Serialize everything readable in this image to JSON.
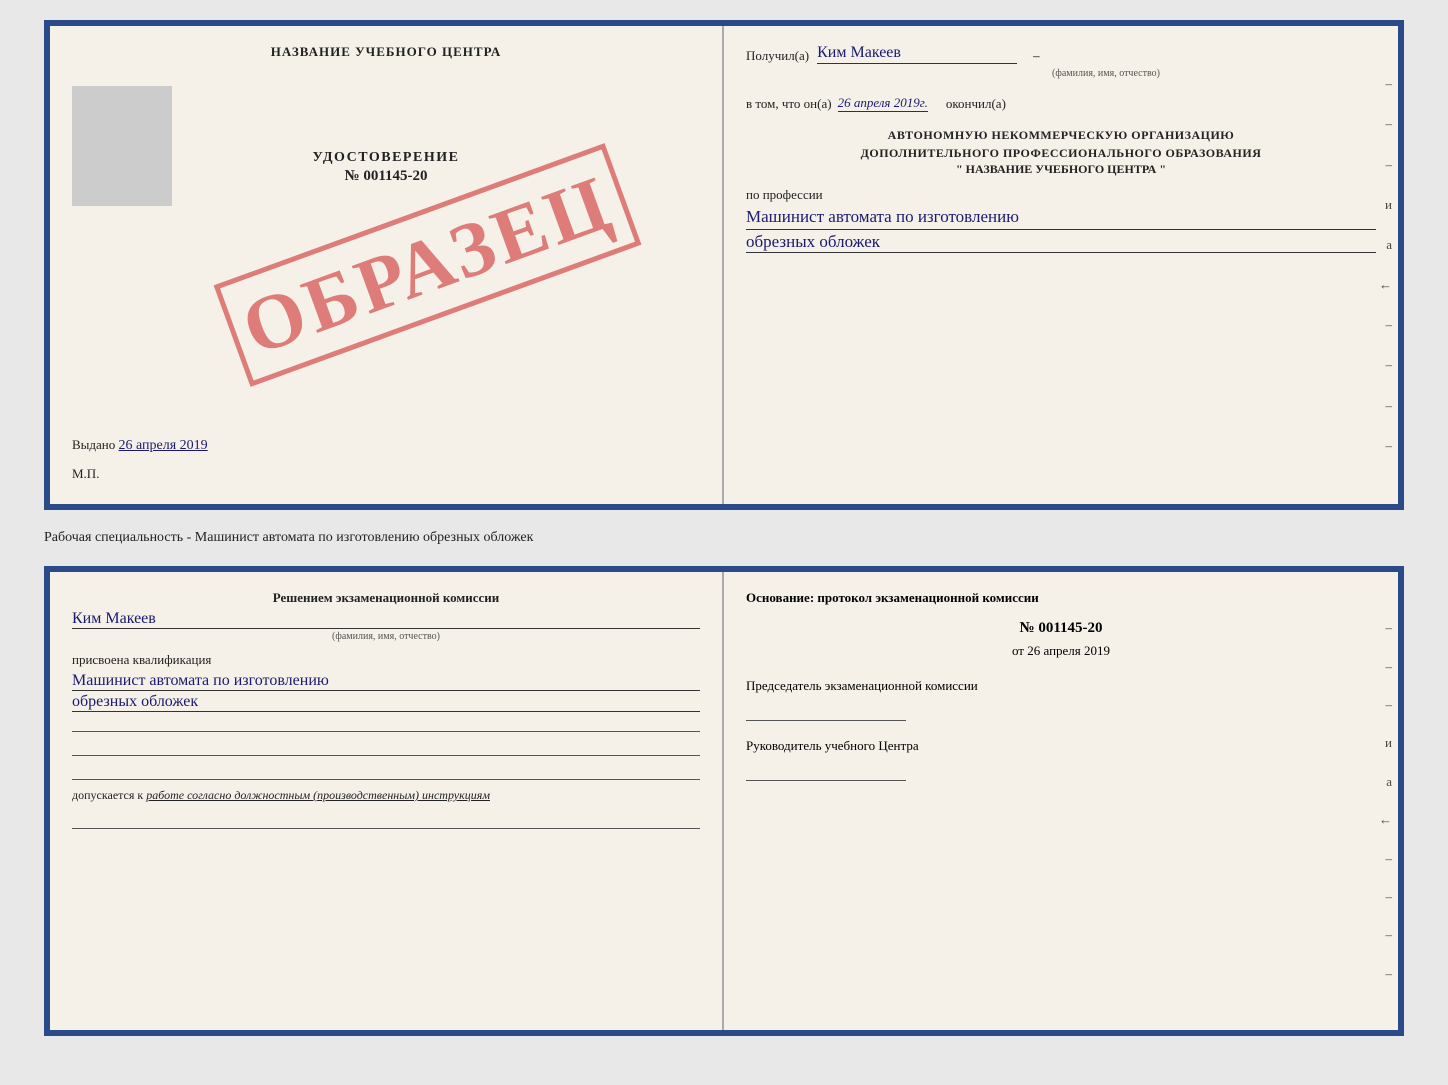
{
  "top_doc": {
    "left": {
      "title": "НАЗВАНИЕ УЧЕБНОГО ЦЕНТРА",
      "stamp": "ОБРАЗЕЦ",
      "udostoverenie": "УДОСТОВЕРЕНИЕ",
      "number": "№ 001145-20",
      "vydano_label": "Выдано",
      "vydano_date": "26 апреля 2019",
      "mp": "М.П."
    },
    "right": {
      "poluchil_label": "Получил(а)",
      "recipient_name": "Ким Макеев",
      "fio_label": "(фамилия, имя, отчество)",
      "vtom_label": "в том, что он(а)",
      "vtom_date": "26 апреля 2019г.",
      "okonchil_label": "окончил(а)",
      "org_line1": "АВТОНОМНУЮ НЕКОММЕРЧЕСКУЮ ОРГАНИЗАЦИЮ",
      "org_line2": "ДОПОЛНИТЕЛЬНОГО ПРОФЕССИОНАЛЬНОГО ОБРАЗОВАНИЯ",
      "org_quote_open": "\"",
      "org_name": "НАЗВАНИЕ УЧЕБНОГО ЦЕНТРА",
      "org_quote_close": "\"",
      "po_professii": "по профессии",
      "profession_line1": "Машинист автомата по изготовлению",
      "profession_line2": "обрезных обложек",
      "dashes": [
        "-",
        "-",
        "-",
        "и",
        "а",
        "←",
        "-",
        "-",
        "-",
        "-"
      ]
    }
  },
  "between_label": "Рабочая специальность - Машинист автомата по изготовлению обрезных обложек",
  "bottom_doc": {
    "left": {
      "resheniem_title": "Решением экзаменационной комиссии",
      "name": "Ким Макеев",
      "fio_label": "(фамилия, имя, отчество)",
      "prisvoena": "присвоена квалификация",
      "kvalif_line1": "Машинист автомата по изготовлению",
      "kvalif_line2": "обрезных обложек",
      "dopuskaetsya_prefix": "допускается к",
      "dopuskaetsya_text": "работе согласно должностным (производственным) инструкциям"
    },
    "right": {
      "osnovanie_title": "Основание: протокол экзаменационной комиссии",
      "protokol_num": "№  001145-20",
      "ot_label": "от",
      "ot_date": "26 апреля 2019",
      "predsedatel_title": "Председатель экзаменационной комиссии",
      "rukovoditel_title": "Руководитель учебного Центра",
      "dashes": [
        "-",
        "-",
        "-",
        "и",
        "а",
        "←",
        "-",
        "-",
        "-",
        "-"
      ]
    }
  }
}
